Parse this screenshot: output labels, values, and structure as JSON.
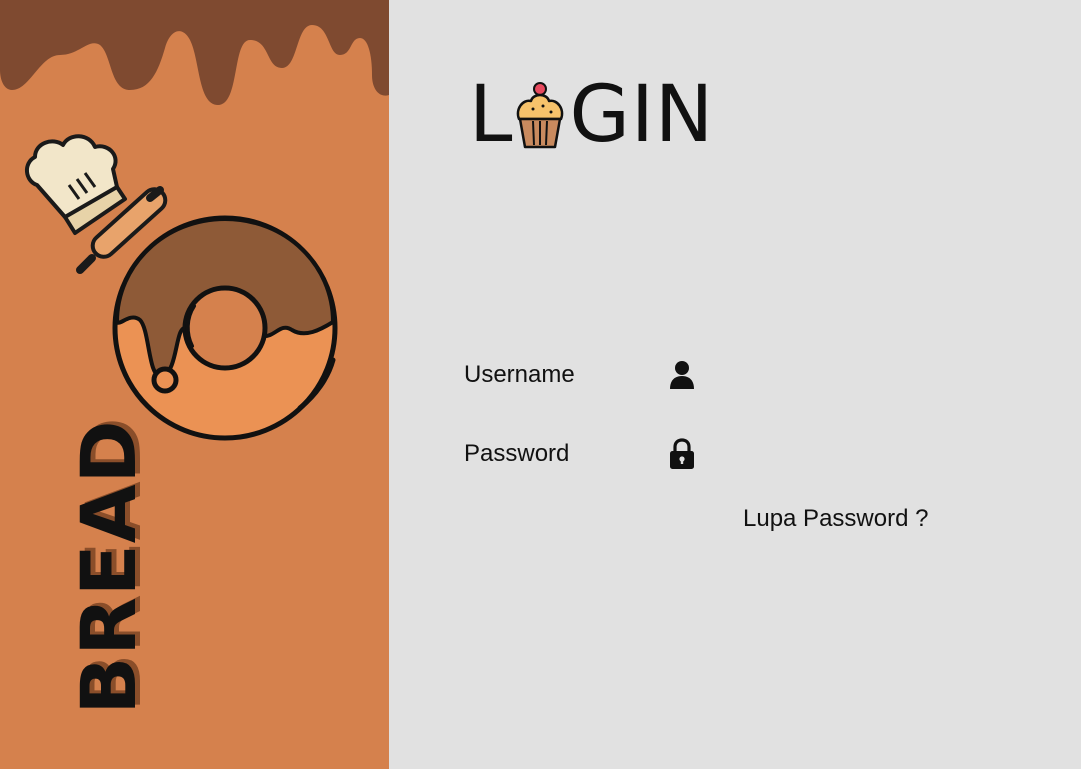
{
  "brand": {
    "name": "BREAD"
  },
  "login": {
    "title_start": "L",
    "title_end": "GIN"
  },
  "form": {
    "username_label": "Username",
    "username_value": "",
    "username_icon": "user-icon",
    "password_label": "Password",
    "password_value": "",
    "password_icon": "lock-icon",
    "forgot_link": "Lupa Password ?"
  },
  "colors": {
    "left_panel": "#d5814d",
    "chocolate": "#7f4a30",
    "right_panel": "#e1e1e1",
    "text": "#111111"
  }
}
